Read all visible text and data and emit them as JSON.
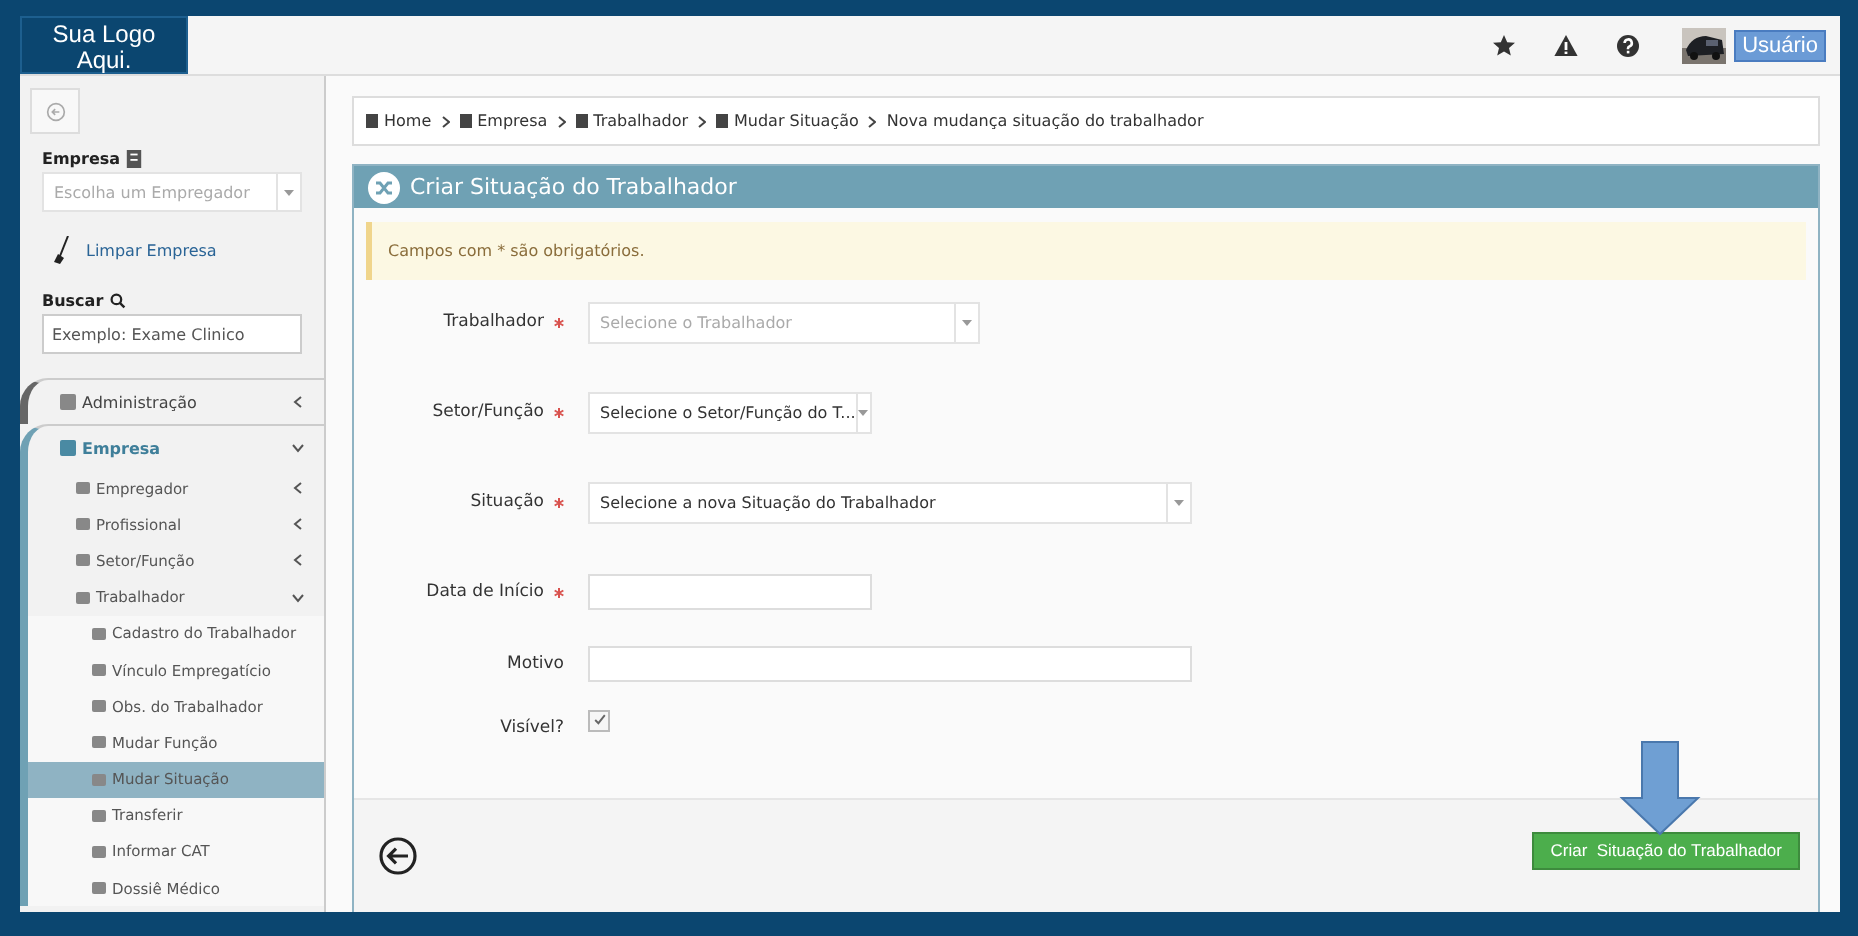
{
  "header": {
    "logo": "Sua Logo Aqui.",
    "user": "Usuário"
  },
  "sidebar": {
    "company_label": "Empresa",
    "company_select": {
      "placeholder": "Escolha um Empregador"
    },
    "clear_link": "Limpar Empresa",
    "search_label": "Buscar",
    "search": {
      "placeholder": "Exemplo: Exame Clinico"
    },
    "items": [
      {
        "label": "Administração",
        "expanded": false,
        "selected": false
      },
      {
        "label": "Empresa",
        "expanded": true,
        "selected": false,
        "children": [
          {
            "label": "Empregador",
            "expanded": false,
            "selected": false
          },
          {
            "label": "Profissional",
            "expanded": false,
            "selected": false
          },
          {
            "label": "Setor/Função",
            "expanded": false,
            "selected": false
          },
          {
            "label": "Trabalhador",
            "expanded": true,
            "selected": false,
            "children": [
              {
                "label": "Cadastro do Trabalhador",
                "selected": false
              },
              {
                "label": "Vínculo Empregatício",
                "selected": false
              },
              {
                "label": "Obs. do Trabalhador",
                "selected": false
              },
              {
                "label": "Mudar Função",
                "selected": false
              },
              {
                "label": "Mudar Situação",
                "selected": true
              },
              {
                "label": "Transferir",
                "selected": false
              },
              {
                "label": "Informar CAT",
                "selected": false
              },
              {
                "label": "Dossiê Médico",
                "selected": false
              }
            ]
          }
        ]
      }
    ]
  },
  "breadcrumb": [
    "Home",
    "Empresa",
    "Trabalhador",
    "Mudar Situação",
    "Nova mudança situação do trabalhador"
  ],
  "panel": {
    "title": "Criar Situação do Trabalhador",
    "notice": "Campos com * são obrigatórios.",
    "fields": [
      {
        "kind": "select",
        "label": "Trabalhador",
        "required": true,
        "placeholder": "Selecione o Trabalhador"
      },
      {
        "kind": "select",
        "label": "Setor/Função",
        "required": true,
        "value": "Selecione o Setor/Função do T..."
      },
      {
        "kind": "select",
        "label": "Situação",
        "required": true,
        "value": "Selecione a nova Situação do Trabalhador"
      },
      {
        "kind": "text",
        "label": "Data de Início",
        "required": true
      },
      {
        "kind": "text",
        "label": "Motivo",
        "required": false
      },
      {
        "kind": "checkbox",
        "label": "Visível?",
        "required": false,
        "checked": true
      }
    ],
    "submit": "Criar  Situação do Trabalhador"
  }
}
